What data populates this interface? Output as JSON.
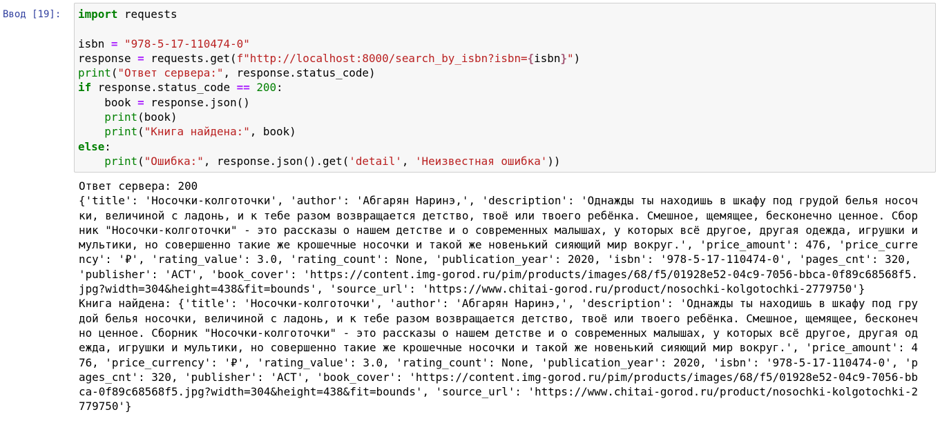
{
  "prompt": "Ввод [19]:",
  "code": {
    "l1_import": "import",
    "l1_module": " requests",
    "l3_var": "isbn ",
    "l3_eq": "=",
    "l3_sp": " ",
    "l3_value": "\"978-5-17-110474-0\"",
    "l4_var": "response ",
    "l4_eq": "=",
    "l4_call": " requests.get(",
    "l4_fstr_a": "f\"http://localhost:8000/search_by_isbn?isbn=",
    "l4_interp_open": "{",
    "l4_interp_var": "isbn",
    "l4_interp_close": "}",
    "l4_fstr_b": "\"",
    "l4_close": ")",
    "l5_print": "print",
    "l5_open": "(",
    "l5_str": "\"Ответ сервера:\"",
    "l5_rest": ", response.status_code)",
    "l6_if": "if",
    "l6_cond": " response.status_code ",
    "l6_op": "==",
    "l6_sp": " ",
    "l6_num": "200",
    "l6_colon": ":",
    "l7_indent": "    ",
    "l7_var": "book ",
    "l7_eq": "=",
    "l7_call": " response.json()",
    "l8_indent": "    ",
    "l8_print": "print",
    "l8_args": "(book)",
    "l9_indent": "    ",
    "l9_print": "print",
    "l9_open": "(",
    "l9_str": "\"Книга найдена:\"",
    "l9_rest": ", book)",
    "l10_else": "else",
    "l10_colon": ":",
    "l11_indent": "    ",
    "l11_print": "print",
    "l11_open": "(",
    "l11_str1": "\"Ошибка:\"",
    "l11_mid": ", response.json().get(",
    "l11_str2": "'detail'",
    "l11_comma": ", ",
    "l11_str3": "'Неизвестная ошибка'",
    "l11_close": "))"
  },
  "output": {
    "lines": [
      "Ответ сервера: 200",
      "{'title': 'Носочки-колготочки', 'author': 'Абгарян Наринэ,', 'description': 'Однажды ты находишь в шкафу под грудой белья носоч",
      "ки, величиной с ладонь, и к тебе разом возвращается детство, твоё или твоего ребёнка. Смешное, щемящее, бесконечно ценное. Сбор",
      "ник \"Носочки-колготочки\" - это рассказы о нашем детстве и о современных малышах, у которых всё другое, другая одежда, игрушки и",
      "мультики, но совершенно такие же крошечные носочки и такой же новенький сияющий мир вокруг.', 'price_amount': 476, 'price_curre",
      "ncy': '₽', 'rating_value': 3.0, 'rating_count': None, 'publication_year': 2020, 'isbn': '978-5-17-110474-0', 'pages_cnt': 320,",
      "'publisher': 'АСТ', 'book_cover': 'https://content.img-gorod.ru/pim/products/images/68/f5/01928e52-04c9-7056-bbca-0f89c68568f5.",
      "jpg?width=304&height=438&fit=bounds', 'source_url': 'https://www.chitai-gorod.ru/product/nosochki-kolgotochki-2779750'}",
      "Книга найдена: {'title': 'Носочки-колготочки', 'author': 'Абгарян Наринэ,', 'description': 'Однажды ты находишь в шкафу под гру",
      "дой белья носочки, величиной с ладонь, и к тебе разом возвращается детство, твоё или твоего ребёнка. Смешное, щемящее, бесконеч",
      "но ценное. Сборник \"Носочки-колготочки\" - это рассказы о нашем детстве и о современных малышах, у которых всё другое, другая од",
      "ежда, игрушки и мультики, но совершенно такие же крошечные носочки и такой же новенький сияющий мир вокруг.', 'price_amount': 4",
      "76, 'price_currency': '₽', 'rating_value': 3.0, 'rating_count': None, 'publication_year': 2020, 'isbn': '978-5-17-110474-0', 'p",
      "ages_cnt': 320, 'publisher': 'АСТ', 'book_cover': 'https://content.img-gorod.ru/pim/products/images/68/f5/01928e52-04c9-7056-bb",
      "ca-0f89c68568f5.jpg?width=304&height=438&fit=bounds', 'source_url': 'https://www.chitai-gorod.ru/product/nosochki-kolgotochki-2",
      "779750'}"
    ]
  }
}
